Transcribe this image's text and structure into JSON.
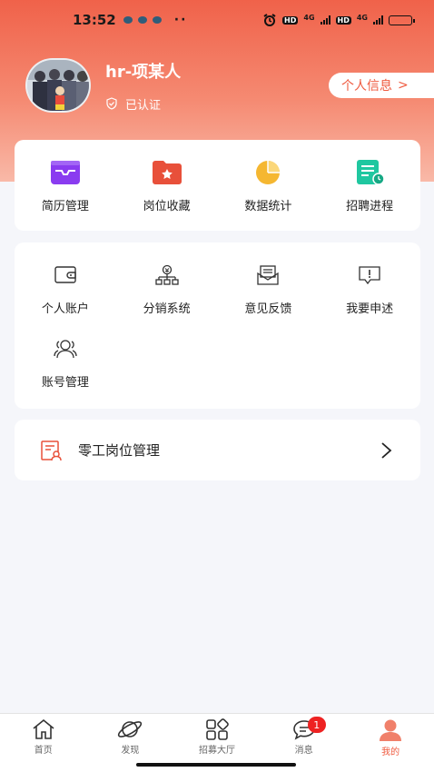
{
  "status_bar": {
    "time": "13:52",
    "more": "··",
    "network_1": "4G",
    "network_2": "4G"
  },
  "profile": {
    "name": "hr-项某人",
    "verified_label": "已认证",
    "info_button_label": "个人信息",
    "info_button_chevron": ">"
  },
  "quick_actions": [
    {
      "label": "简历管理",
      "icon": "inbox-icon",
      "color": "#8a3cf0"
    },
    {
      "label": "岗位收藏",
      "icon": "star-folder-icon",
      "color": "#e8503a"
    },
    {
      "label": "数据统计",
      "icon": "pie-chart-icon",
      "color": "#f5b731"
    },
    {
      "label": "招聘进程",
      "icon": "document-clock-icon",
      "color": "#1fc7a0"
    }
  ],
  "services": [
    {
      "label": "个人账户",
      "icon": "wallet-icon"
    },
    {
      "label": "分销系统",
      "icon": "distribution-icon"
    },
    {
      "label": "意见反馈",
      "icon": "feedback-mail-icon"
    },
    {
      "label": "我要申述",
      "icon": "alert-message-icon"
    },
    {
      "label": "账号管理",
      "icon": "users-icon"
    }
  ],
  "gig_management": {
    "label": "零工岗位管理",
    "icon": "certificate-user-icon",
    "arrow": ">"
  },
  "tabbar": {
    "items": [
      {
        "label": "首页",
        "icon": "home-icon"
      },
      {
        "label": "发现",
        "icon": "planet-icon"
      },
      {
        "label": "招募大厅",
        "icon": "grid-icon"
      },
      {
        "label": "消息",
        "icon": "chat-icon",
        "badge": "1"
      },
      {
        "label": "我的",
        "icon": "profile-icon",
        "active": true
      }
    ]
  },
  "colors": {
    "accent": "#ef5a3f",
    "header_top": "#f0624a",
    "page_bg": "#f5f6fa"
  }
}
